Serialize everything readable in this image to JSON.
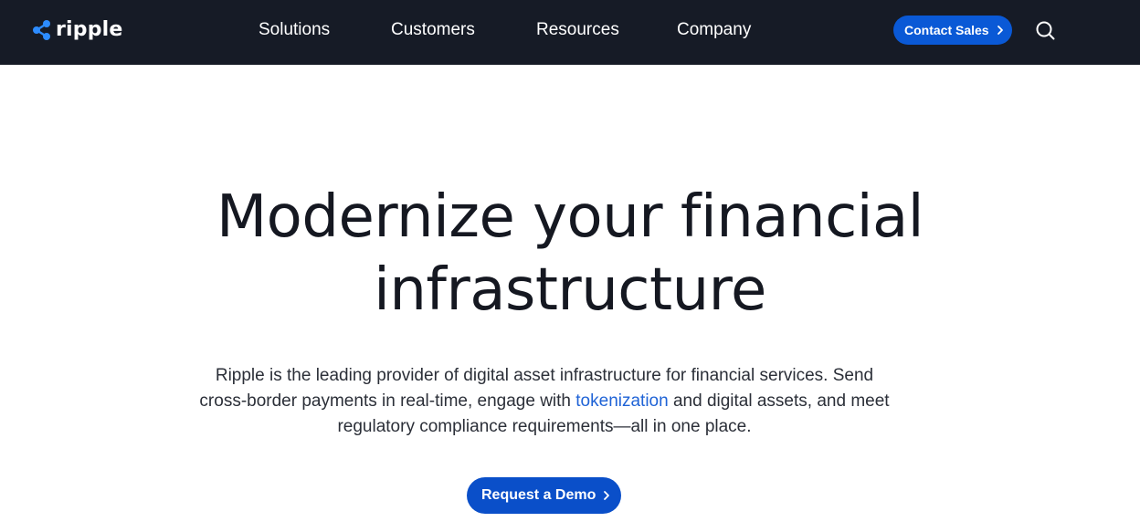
{
  "header": {
    "logo_text": "ripple",
    "nav": [
      {
        "label": "Solutions"
      },
      {
        "label": "Customers"
      },
      {
        "label": "Resources"
      },
      {
        "label": "Company"
      }
    ],
    "contact_label": "Contact Sales",
    "icons": {
      "logo": "ripple-logo-icon",
      "search": "search-icon",
      "chevron": "chevron-right-icon"
    }
  },
  "hero": {
    "headline_line1": "Modernize your financial",
    "headline_line2": "infrastructure",
    "body_part1": "Ripple is the leading provider of digital asset infrastructure for financial services. Send cross-border payments in real-time, engage with ",
    "body_link": "tokenization",
    "body_part2": " and digital assets, and meet regulatory compliance requirements—all in one place.",
    "cta_label": "Request a Demo"
  },
  "colors": {
    "header_bg": "#161b26",
    "button_blue": "#0a59d6",
    "link_blue": "#1f63d6",
    "text_dark": "#151821"
  }
}
